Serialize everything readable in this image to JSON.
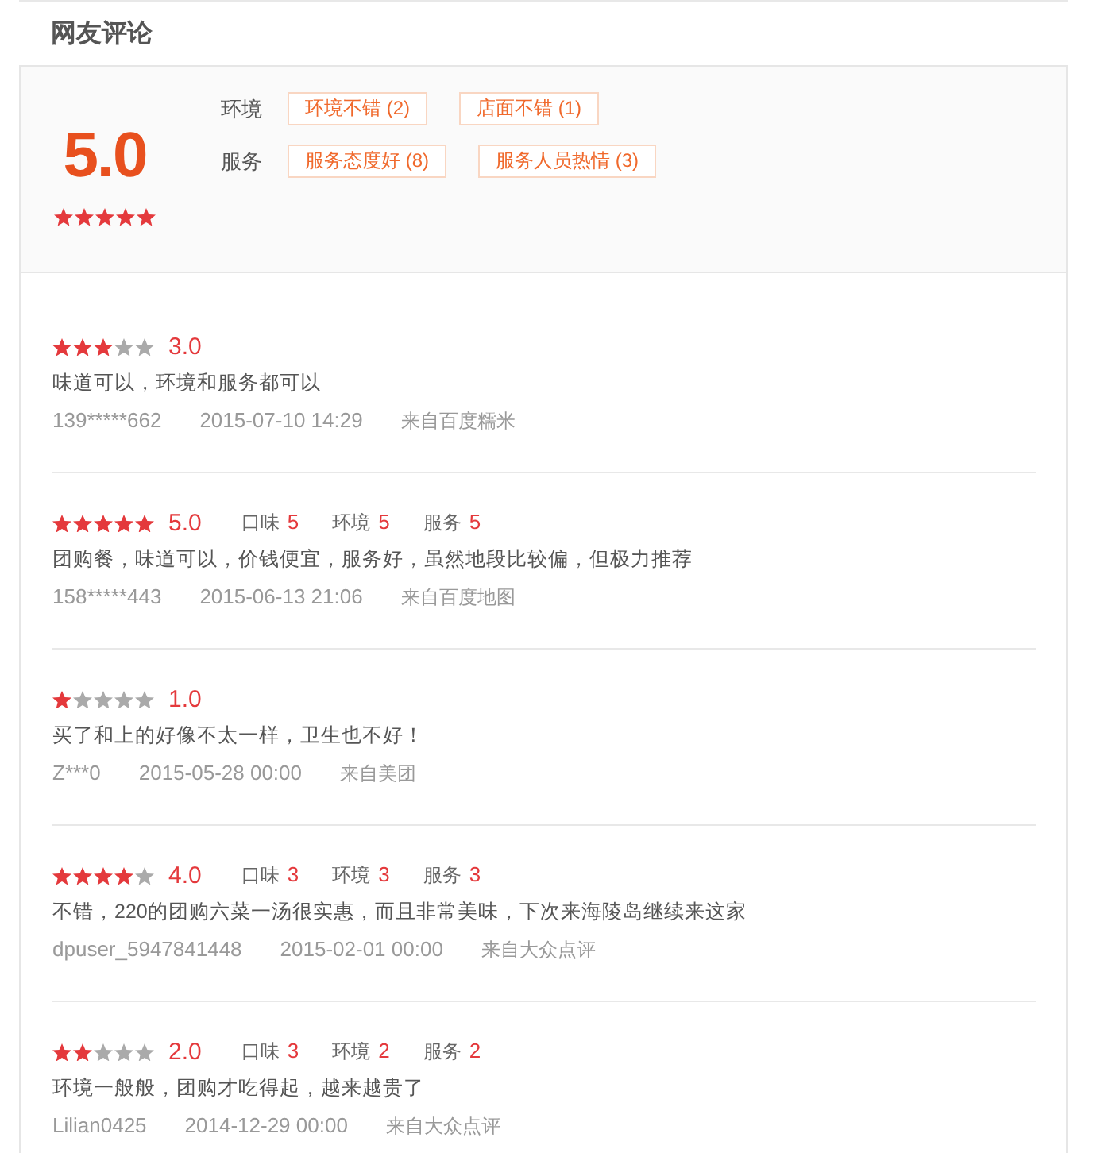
{
  "header": {
    "title": "网友评论"
  },
  "summary": {
    "score": "5.0",
    "stars": 5,
    "tag_groups": [
      {
        "label": "环境",
        "tags": [
          "环境不错 (2)",
          "店面不错 (1)"
        ]
      },
      {
        "label": "服务",
        "tags": [
          "服务态度好 (8)",
          "服务人员热情 (3)"
        ]
      }
    ]
  },
  "reviews": [
    {
      "stars": 3,
      "score": "3.0",
      "text": "味道可以，环境和服务都可以",
      "user": "139*****662",
      "time": "2015-07-10 14:29",
      "source": "来自百度糯米"
    },
    {
      "stars": 5,
      "score": "5.0",
      "sub_scores": [
        {
          "label": "口味",
          "value": "5"
        },
        {
          "label": "环境",
          "value": "5"
        },
        {
          "label": "服务",
          "value": "5"
        }
      ],
      "text": "团购餐，味道可以，价钱便宜，服务好，虽然地段比较偏，但极力推荐",
      "user": "158*****443",
      "time": "2015-06-13 21:06",
      "source": "来自百度地图"
    },
    {
      "stars": 1,
      "score": "1.0",
      "text": "买了和上的好像不太一样，卫生也不好！",
      "user": "Z***0",
      "time": "2015-05-28 00:00",
      "source": "来自美团"
    },
    {
      "stars": 4,
      "score": "4.0",
      "sub_scores": [
        {
          "label": "口味",
          "value": "3"
        },
        {
          "label": "环境",
          "value": "3"
        },
        {
          "label": "服务",
          "value": "3"
        }
      ],
      "text": "不错，220的团购六菜一汤很实惠，而且非常美味，下次来海陵岛继续来这家",
      "user": "dpuser_5947841448",
      "time": "2015-02-01 00:00",
      "source": "来自大众点评"
    },
    {
      "stars": 2,
      "score": "2.0",
      "sub_scores": [
        {
          "label": "口味",
          "value": "3"
        },
        {
          "label": "环境",
          "value": "2"
        },
        {
          "label": "服务",
          "value": "2"
        }
      ],
      "text": "环境一般般，团购才吃得起，越来越贵了",
      "user": "Lilian0425",
      "time": "2014-12-29 00:00",
      "source": "来自大众点评"
    }
  ]
}
